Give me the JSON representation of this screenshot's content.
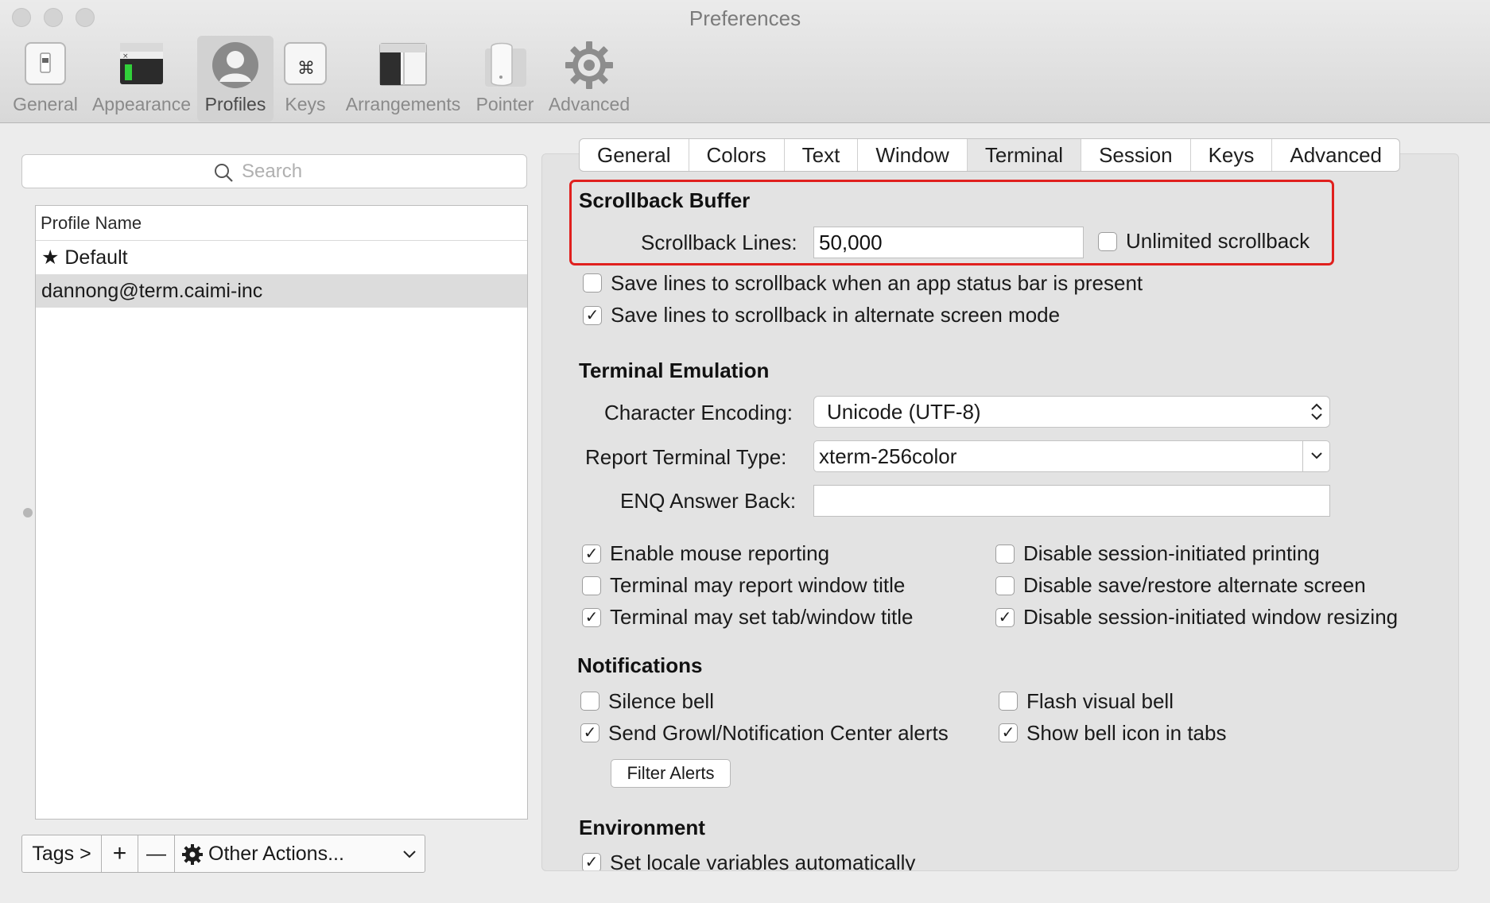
{
  "window": {
    "title": "Preferences"
  },
  "toolbar": {
    "items": [
      {
        "label": "General",
        "icon": "general-switch-icon"
      },
      {
        "label": "Appearance",
        "icon": "appearance-terminal-icon"
      },
      {
        "label": "Profiles",
        "icon": "profiles-person-icon",
        "selected": true
      },
      {
        "label": "Keys",
        "icon": "keys-command-icon"
      },
      {
        "label": "Arrangements",
        "icon": "arrangements-window-icon"
      },
      {
        "label": "Pointer",
        "icon": "pointer-mouse-icon"
      },
      {
        "label": "Advanced",
        "icon": "advanced-gear-icon"
      }
    ]
  },
  "profiles": {
    "search_placeholder": "Search",
    "column_header": "Profile Name",
    "rows": [
      {
        "label": "★ Default"
      },
      {
        "label": "dannong@term.caimi-inc",
        "selected": true
      }
    ],
    "bottom_bar": {
      "tags": "Tags >",
      "add": "+",
      "remove": "—",
      "other": "Other Actions..."
    }
  },
  "tabs": [
    {
      "label": "General"
    },
    {
      "label": "Colors"
    },
    {
      "label": "Text"
    },
    {
      "label": "Window"
    },
    {
      "label": "Terminal",
      "selected": true
    },
    {
      "label": "Session"
    },
    {
      "label": "Keys"
    },
    {
      "label": "Advanced"
    }
  ],
  "terminal": {
    "scrollback": {
      "title": "Scrollback Buffer",
      "lines_label": "Scrollback Lines:",
      "lines_value": "50,000",
      "unlimited_label": "Unlimited scrollback",
      "unlimited_checked": false,
      "status_bar_label": "Save lines to scrollback when an app status bar is present",
      "status_bar_checked": false,
      "alternate_label": "Save lines to scrollback in alternate screen mode",
      "alternate_checked": true
    },
    "emulation": {
      "title": "Terminal Emulation",
      "encoding_label": "Character Encoding:",
      "encoding_value": "Unicode (UTF-8)",
      "type_label": "Report Terminal Type:",
      "type_value": "xterm-256color",
      "enq_label": "ENQ Answer Back:",
      "enq_value": "",
      "options_left": [
        {
          "label": "Enable mouse reporting",
          "checked": true
        },
        {
          "label": "Terminal may report window title",
          "checked": false
        },
        {
          "label": "Terminal may set tab/window title",
          "checked": true
        }
      ],
      "options_right": [
        {
          "label": "Disable session-initiated printing",
          "checked": false
        },
        {
          "label": "Disable save/restore alternate screen",
          "checked": false
        },
        {
          "label": "Disable session-initiated window resizing",
          "checked": true
        }
      ]
    },
    "notifications": {
      "title": "Notifications",
      "options_left": [
        {
          "label": "Silence bell",
          "checked": false
        },
        {
          "label": "Send Growl/Notification Center alerts",
          "checked": true
        }
      ],
      "options_right": [
        {
          "label": "Flash visual bell",
          "checked": false
        },
        {
          "label": "Show bell icon in tabs",
          "checked": true
        }
      ],
      "filter_button": "Filter Alerts"
    },
    "environment": {
      "title": "Environment",
      "locale_label": "Set locale variables automatically",
      "locale_checked": true
    }
  },
  "colors": {
    "highlight": "#e0201e",
    "selection": "#dcdcdc"
  }
}
